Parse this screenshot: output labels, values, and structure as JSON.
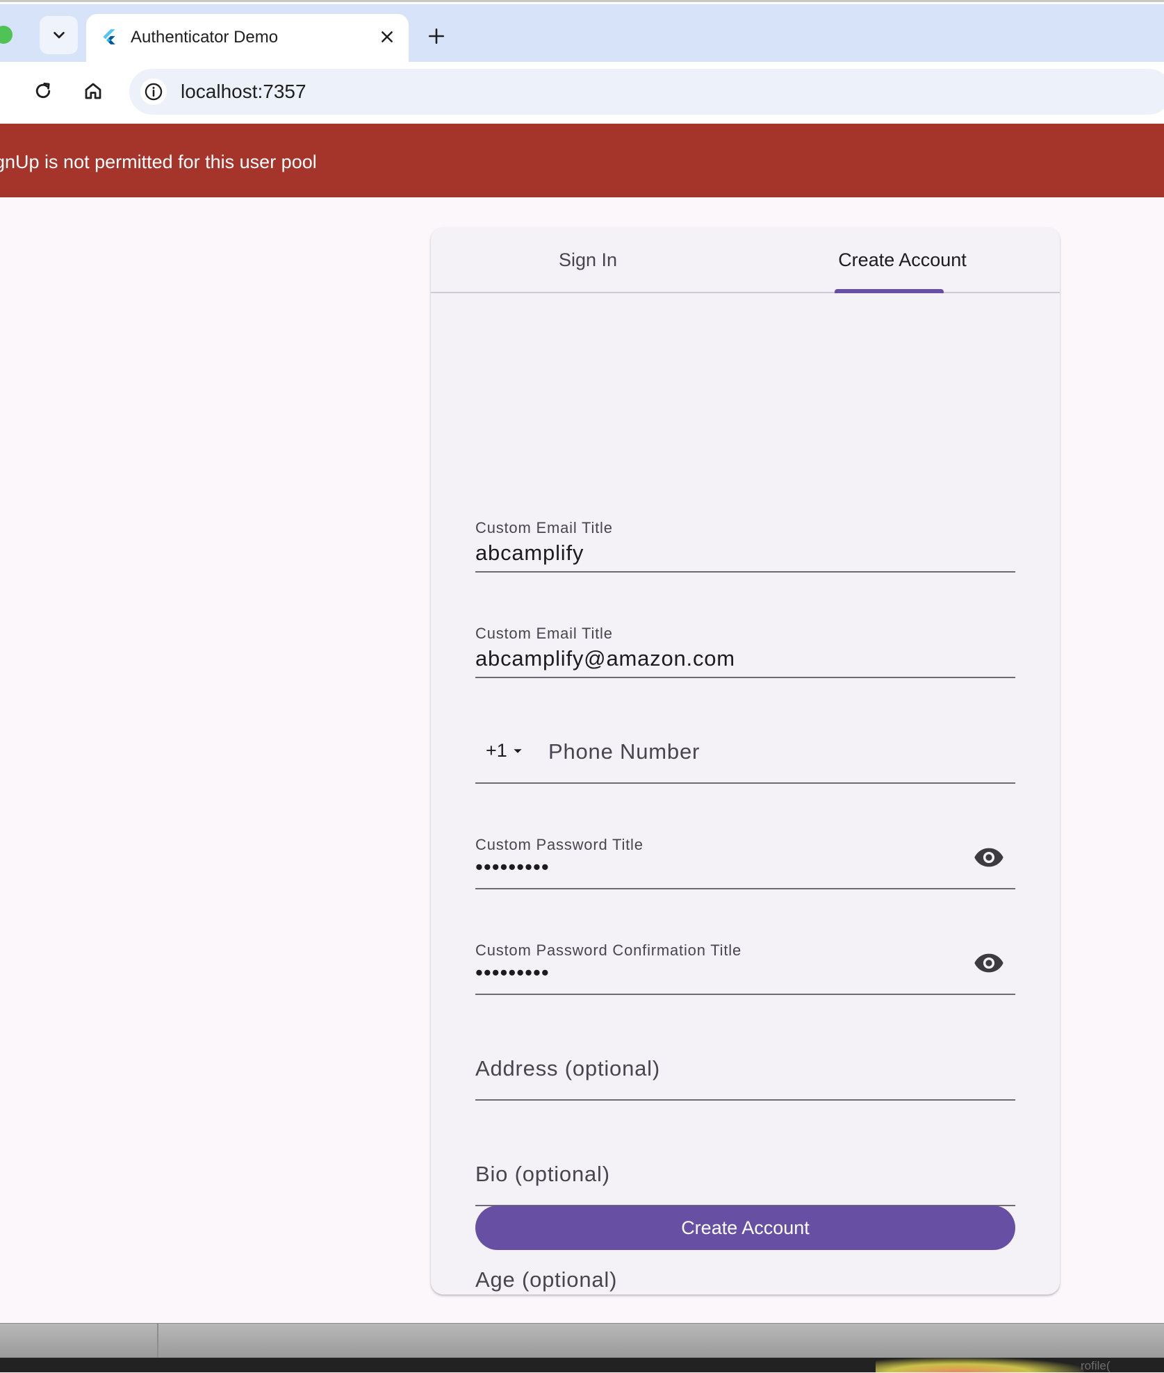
{
  "browser": {
    "tab_title": "Authenticator Demo",
    "url": "localhost:7357"
  },
  "banner": {
    "message": "ignUp is not permitted for this user pool"
  },
  "auth_tabs": {
    "sign_in": "Sign In",
    "create_account": "Create Account"
  },
  "form": {
    "username": {
      "label": "Custom Email Title",
      "value": "abcamplify"
    },
    "email": {
      "label": "Custom Email Title",
      "value": "abcamplify@amazon.com"
    },
    "phone": {
      "country_code": "+1",
      "placeholder": "Phone Number"
    },
    "password": {
      "label": "Custom Password Title",
      "masked_value": "•••••••••"
    },
    "password_confirm": {
      "label": "Custom Password Confirmation Title",
      "masked_value": "•••••••••"
    },
    "address": {
      "placeholder": "Address (optional)"
    },
    "bio": {
      "placeholder": "Bio (optional)"
    },
    "age": {
      "placeholder": "Age (optional)"
    },
    "submit_label": "Create Account"
  },
  "dock": {
    "partial_text": "rofile("
  },
  "colors": {
    "accent": "#6750a4",
    "error_banner": "#a5352a",
    "card_bg": "#f4f1f7",
    "page_bg": "#fbf7fb",
    "tabstrip": "#d7e3f8"
  },
  "icons": {
    "tab_search": "chevron-down-icon",
    "favicon": "flutter-icon",
    "close": "close-icon",
    "new_tab": "plus-icon",
    "reload": "reload-icon",
    "home": "home-icon",
    "site_info": "info-icon",
    "password_toggle": "eye-icon",
    "country_dropdown": "caret-down-icon"
  }
}
